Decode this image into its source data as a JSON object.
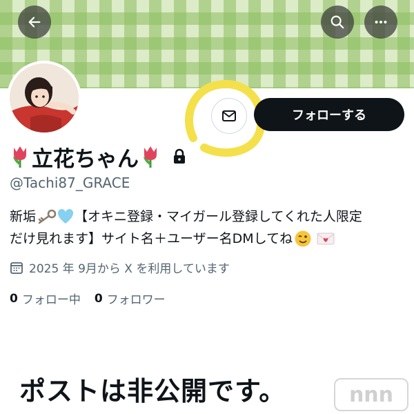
{
  "profile": {
    "display_name": "立花ちゃん",
    "handle": "@Tachi87_GRACE",
    "bio_line1_prefix": "新垢",
    "bio_line1_rest": "【オキニ登録・マイガール登録してくれた人限定",
    "bio_line2": "だけ見れます】サイト名＋ユーザー名DMしてね",
    "joined": "2025 年 9月から X を利用しています",
    "following_count": "0",
    "following_label": "フォロー中",
    "followers_count": "0",
    "followers_label": "フォロワー",
    "private_notice": "ポストは非公開です。"
  },
  "actions": {
    "follow_label": "フォローする"
  },
  "icons": {
    "back": "arrow-left-icon",
    "search": "search-icon",
    "more": "more-horizontal-icon",
    "message": "envelope-icon",
    "lock": "lock-icon",
    "calendar": "calendar-icon",
    "tulip": "tulip-emoji",
    "key": "key-emoji",
    "heart": "light-blue-heart-emoji",
    "wink": "winking-face-emoji",
    "love_letter": "love-letter-emoji"
  },
  "watermark_text": "nnn",
  "colors": {
    "follow_button": "#0f1419",
    "banner_light": "#dcebc8",
    "banner_dark": "#8cbe5f",
    "highlight": "#f4e04a",
    "secondary_text": "#536471"
  }
}
